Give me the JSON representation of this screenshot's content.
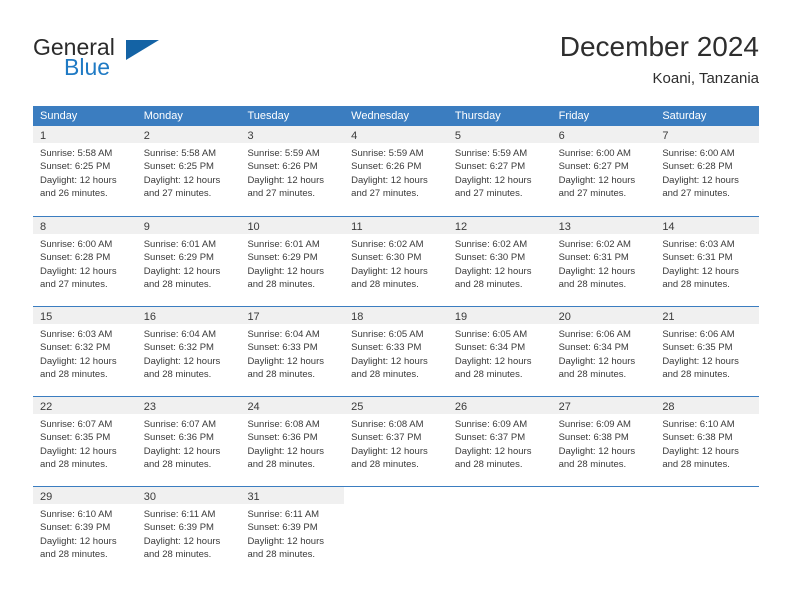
{
  "brand": {
    "word_one": "General",
    "word_two": "Blue",
    "mark": "triangle-logo"
  },
  "header": {
    "title": "December 2024",
    "subtitle": "Koani, Tanzania"
  },
  "calendar": {
    "weekdays": [
      "Sunday",
      "Monday",
      "Tuesday",
      "Wednesday",
      "Thursday",
      "Friday",
      "Saturday"
    ],
    "colors": {
      "header_bg": "#3b7dc0",
      "header_text": "#ffffff",
      "daynum_band_bg": "#f0f0f0",
      "row_border": "#3b7dc0",
      "brand_blue": "#1f7ac4"
    },
    "weeks": [
      [
        {
          "day": "1",
          "lines": [
            "Sunrise: 5:58 AM",
            "Sunset: 6:25 PM",
            "Daylight: 12 hours",
            "and 26 minutes."
          ]
        },
        {
          "day": "2",
          "lines": [
            "Sunrise: 5:58 AM",
            "Sunset: 6:25 PM",
            "Daylight: 12 hours",
            "and 27 minutes."
          ]
        },
        {
          "day": "3",
          "lines": [
            "Sunrise: 5:59 AM",
            "Sunset: 6:26 PM",
            "Daylight: 12 hours",
            "and 27 minutes."
          ]
        },
        {
          "day": "4",
          "lines": [
            "Sunrise: 5:59 AM",
            "Sunset: 6:26 PM",
            "Daylight: 12 hours",
            "and 27 minutes."
          ]
        },
        {
          "day": "5",
          "lines": [
            "Sunrise: 5:59 AM",
            "Sunset: 6:27 PM",
            "Daylight: 12 hours",
            "and 27 minutes."
          ]
        },
        {
          "day": "6",
          "lines": [
            "Sunrise: 6:00 AM",
            "Sunset: 6:27 PM",
            "Daylight: 12 hours",
            "and 27 minutes."
          ]
        },
        {
          "day": "7",
          "lines": [
            "Sunrise: 6:00 AM",
            "Sunset: 6:28 PM",
            "Daylight: 12 hours",
            "and 27 minutes."
          ]
        }
      ],
      [
        {
          "day": "8",
          "lines": [
            "Sunrise: 6:00 AM",
            "Sunset: 6:28 PM",
            "Daylight: 12 hours",
            "and 27 minutes."
          ]
        },
        {
          "day": "9",
          "lines": [
            "Sunrise: 6:01 AM",
            "Sunset: 6:29 PM",
            "Daylight: 12 hours",
            "and 28 minutes."
          ]
        },
        {
          "day": "10",
          "lines": [
            "Sunrise: 6:01 AM",
            "Sunset: 6:29 PM",
            "Daylight: 12 hours",
            "and 28 minutes."
          ]
        },
        {
          "day": "11",
          "lines": [
            "Sunrise: 6:02 AM",
            "Sunset: 6:30 PM",
            "Daylight: 12 hours",
            "and 28 minutes."
          ]
        },
        {
          "day": "12",
          "lines": [
            "Sunrise: 6:02 AM",
            "Sunset: 6:30 PM",
            "Daylight: 12 hours",
            "and 28 minutes."
          ]
        },
        {
          "day": "13",
          "lines": [
            "Sunrise: 6:02 AM",
            "Sunset: 6:31 PM",
            "Daylight: 12 hours",
            "and 28 minutes."
          ]
        },
        {
          "day": "14",
          "lines": [
            "Sunrise: 6:03 AM",
            "Sunset: 6:31 PM",
            "Daylight: 12 hours",
            "and 28 minutes."
          ]
        }
      ],
      [
        {
          "day": "15",
          "lines": [
            "Sunrise: 6:03 AM",
            "Sunset: 6:32 PM",
            "Daylight: 12 hours",
            "and 28 minutes."
          ]
        },
        {
          "day": "16",
          "lines": [
            "Sunrise: 6:04 AM",
            "Sunset: 6:32 PM",
            "Daylight: 12 hours",
            "and 28 minutes."
          ]
        },
        {
          "day": "17",
          "lines": [
            "Sunrise: 6:04 AM",
            "Sunset: 6:33 PM",
            "Daylight: 12 hours",
            "and 28 minutes."
          ]
        },
        {
          "day": "18",
          "lines": [
            "Sunrise: 6:05 AM",
            "Sunset: 6:33 PM",
            "Daylight: 12 hours",
            "and 28 minutes."
          ]
        },
        {
          "day": "19",
          "lines": [
            "Sunrise: 6:05 AM",
            "Sunset: 6:34 PM",
            "Daylight: 12 hours",
            "and 28 minutes."
          ]
        },
        {
          "day": "20",
          "lines": [
            "Sunrise: 6:06 AM",
            "Sunset: 6:34 PM",
            "Daylight: 12 hours",
            "and 28 minutes."
          ]
        },
        {
          "day": "21",
          "lines": [
            "Sunrise: 6:06 AM",
            "Sunset: 6:35 PM",
            "Daylight: 12 hours",
            "and 28 minutes."
          ]
        }
      ],
      [
        {
          "day": "22",
          "lines": [
            "Sunrise: 6:07 AM",
            "Sunset: 6:35 PM",
            "Daylight: 12 hours",
            "and 28 minutes."
          ]
        },
        {
          "day": "23",
          "lines": [
            "Sunrise: 6:07 AM",
            "Sunset: 6:36 PM",
            "Daylight: 12 hours",
            "and 28 minutes."
          ]
        },
        {
          "day": "24",
          "lines": [
            "Sunrise: 6:08 AM",
            "Sunset: 6:36 PM",
            "Daylight: 12 hours",
            "and 28 minutes."
          ]
        },
        {
          "day": "25",
          "lines": [
            "Sunrise: 6:08 AM",
            "Sunset: 6:37 PM",
            "Daylight: 12 hours",
            "and 28 minutes."
          ]
        },
        {
          "day": "26",
          "lines": [
            "Sunrise: 6:09 AM",
            "Sunset: 6:37 PM",
            "Daylight: 12 hours",
            "and 28 minutes."
          ]
        },
        {
          "day": "27",
          "lines": [
            "Sunrise: 6:09 AM",
            "Sunset: 6:38 PM",
            "Daylight: 12 hours",
            "and 28 minutes."
          ]
        },
        {
          "day": "28",
          "lines": [
            "Sunrise: 6:10 AM",
            "Sunset: 6:38 PM",
            "Daylight: 12 hours",
            "and 28 minutes."
          ]
        }
      ],
      [
        {
          "day": "29",
          "lines": [
            "Sunrise: 6:10 AM",
            "Sunset: 6:39 PM",
            "Daylight: 12 hours",
            "and 28 minutes."
          ]
        },
        {
          "day": "30",
          "lines": [
            "Sunrise: 6:11 AM",
            "Sunset: 6:39 PM",
            "Daylight: 12 hours",
            "and 28 minutes."
          ]
        },
        {
          "day": "31",
          "lines": [
            "Sunrise: 6:11 AM",
            "Sunset: 6:39 PM",
            "Daylight: 12 hours",
            "and 28 minutes."
          ]
        },
        {
          "day": "",
          "lines": []
        },
        {
          "day": "",
          "lines": []
        },
        {
          "day": "",
          "lines": []
        },
        {
          "day": "",
          "lines": []
        }
      ]
    ]
  }
}
